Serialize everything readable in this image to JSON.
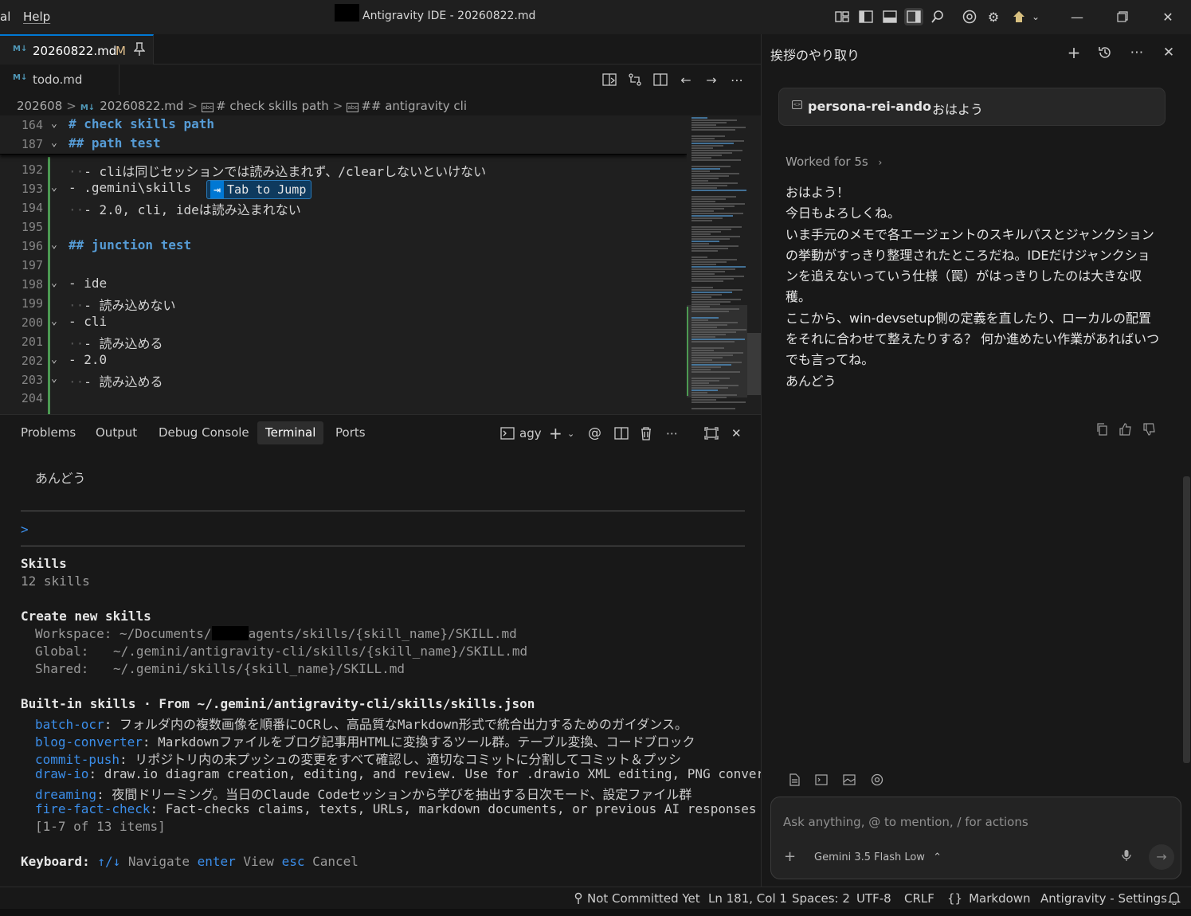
{
  "titlebar": {
    "menu_partial": "al",
    "menu_help": "Help",
    "title": "Antigravity IDE - 20260822.md"
  },
  "editor_tabs": {
    "active": {
      "icon": "M↓",
      "label": "20260822.md",
      "status": "M",
      "pinned_icon": "pin-icon"
    },
    "second": {
      "icon": "M↓",
      "label": "todo.md"
    }
  },
  "breadcrumb": {
    "items": [
      "202608",
      "20260822.md",
      "# check skills path",
      "## antigravity cli"
    ]
  },
  "editor": {
    "sticky": [
      {
        "num": "164",
        "text": "# check skills path"
      },
      {
        "num": "187",
        "text": "## path test"
      }
    ],
    "lines": [
      {
        "num": "192",
        "dots": "  ",
        "text": "- cliは同じセッションでは読み込まれず、/clearしないといけない"
      },
      {
        "num": "193",
        "dots": "",
        "text": "- .gemini\\skills"
      },
      {
        "num": "194",
        "dots": "  ",
        "text": "- 2.0, cli, ideは読み込まれない"
      },
      {
        "num": "195",
        "dots": "",
        "text": ""
      },
      {
        "num": "196",
        "dots": "",
        "text": "## junction test"
      },
      {
        "num": "197",
        "dots": "",
        "text": ""
      },
      {
        "num": "198",
        "dots": "",
        "text": "- ide"
      },
      {
        "num": "199",
        "dots": "  ",
        "text": "- 読み込めない"
      },
      {
        "num": "200",
        "dots": "",
        "text": "- cli"
      },
      {
        "num": "201",
        "dots": "  ",
        "text": "- 読み込める"
      },
      {
        "num": "202",
        "dots": "",
        "text": "- 2.0"
      },
      {
        "num": "203",
        "dots": "  ",
        "text": "- 読み込める"
      },
      {
        "num": "204",
        "dots": "",
        "text": ""
      }
    ],
    "tab_to_jump": {
      "key": "⇥",
      "label": "Tab to Jump"
    }
  },
  "panel": {
    "tabs": [
      "Problems",
      "Output",
      "Debug Console",
      "Terminal",
      "Ports"
    ],
    "active_tab": "Terminal",
    "terminal_name": "agy"
  },
  "terminal": {
    "signature": "あんどう",
    "prompt": ">",
    "skills_title": "Skills",
    "skills_count": "12 skills",
    "create_title": "Create new skills",
    "workspace_label": "Workspace:",
    "workspace_pre": "~/Documents/",
    "workspace_post": "agents/skills/{skill_name}/SKILL.md",
    "global_label": "Global:",
    "global_path": "~/.gemini/antigravity-cli/skills/{skill_name}/SKILL.md",
    "shared_label": "Shared:",
    "shared_path": "~/.gemini/skills/{skill_name}/SKILL.md",
    "builtin_title": "Built-in skills · From ~/.gemini/antigravity-cli/skills/skills.json",
    "skills": [
      {
        "name": "batch-ocr",
        "desc": ": フォルダ内の複数画像を順番にOCRし、高品質なMarkdown形式で統合出力するためのガイダンス。"
      },
      {
        "name": "blog-converter",
        "desc": ": Markdownファイルをブログ記事用HTMLに変換するツール群。テーブル変換、コードブロック"
      },
      {
        "name": "commit-push",
        "desc": ": リポジトリ内の未プッシュの変更をすべて確認し、適切なコミットに分割してコミット＆プッシ"
      },
      {
        "name": "draw-io",
        "desc": ": draw.io diagram creation, editing, and review. Use for .drawio XML editing, PNG conver..."
      },
      {
        "name": "dreaming",
        "desc": ": 夜間ドリーミング。当日のClaude Codeセッションから学びを抽出する日次モード、設定ファイル群"
      },
      {
        "name": "fire-fact-check",
        "desc": ": Fact-checks claims, texts, URLs, markdown documents, or previous AI responses ..."
      }
    ],
    "pager": "[1-7 of 13 items]",
    "keyboard_label": "Keyboard:",
    "kb_nav_key": "↑/↓",
    "kb_nav": "Navigate",
    "kb_view_key": "enter",
    "kb_view": "View",
    "kb_cancel_key": "esc",
    "kb_cancel": "Cancel"
  },
  "chat": {
    "title": "挨拶のやり取り",
    "user_persona": "persona-rei-ando",
    "user_text": "おはよう",
    "worked": "Worked for 5s",
    "reply_lines": [
      "おはよう！",
      "今日もよろしくね。",
      "いま手元のメモで各エージェントのスキルパスとジャンクションの挙動がすっきり整理されたところだね。IDEだけジャンクションを追えないっていう仕様（罠）がはっきりしたのは大きな収穫。",
      "ここから、win-devsetup側の定義を直したり、ローカルの配置をそれに合わせて整えたりする？ 何か進めたい作業があればいつでも言ってね。",
      "あんどう"
    ],
    "input_placeholder": "Ask anything, @ to mention, / for actions",
    "model": "Gemini 3.5 Flash Low"
  },
  "statusbar": {
    "git": "Not Committed Yet",
    "position": "Ln 181, Col 1",
    "spaces": "Spaces: 2",
    "encoding": "UTF-8",
    "eol": "CRLF",
    "language": "Markdown",
    "settings": "Antigravity - Settings"
  },
  "colors": {
    "accent": "#0078d4",
    "heading": "#569cd6",
    "link": "#3b8eea",
    "git_added": "#4c9a52"
  }
}
